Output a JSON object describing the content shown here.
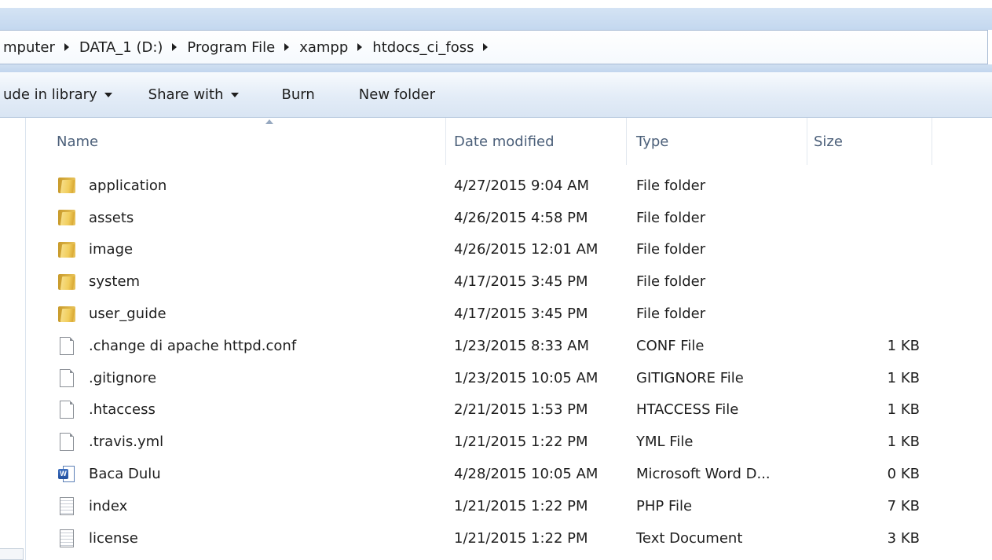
{
  "breadcrumbs": [
    {
      "label": "mputer"
    },
    {
      "label": "DATA_1 (D:)"
    },
    {
      "label": "Program File"
    },
    {
      "label": "xampp"
    },
    {
      "label": "htdocs_ci_foss"
    }
  ],
  "toolbar": {
    "include_library_label": "ude in library",
    "share_with_label": "Share with",
    "burn_label": "Burn",
    "new_folder_label": "New folder"
  },
  "columns": {
    "name": "Name",
    "date": "Date modified",
    "type": "Type",
    "size": "Size"
  },
  "files": [
    {
      "name": "application",
      "date": "4/27/2015 9:04 AM",
      "type": "File folder",
      "size": "",
      "icon": "folder-icon"
    },
    {
      "name": "assets",
      "date": "4/26/2015 4:58 PM",
      "type": "File folder",
      "size": "",
      "icon": "folder-icon"
    },
    {
      "name": "image",
      "date": "4/26/2015 12:01 AM",
      "type": "File folder",
      "size": "",
      "icon": "folder-icon"
    },
    {
      "name": "system",
      "date": "4/17/2015 3:45 PM",
      "type": "File folder",
      "size": "",
      "icon": "folder-icon"
    },
    {
      "name": "user_guide",
      "date": "4/17/2015 3:45 PM",
      "type": "File folder",
      "size": "",
      "icon": "folder-icon"
    },
    {
      "name": ".change di apache httpd.conf",
      "date": "1/23/2015 8:33 AM",
      "type": "CONF File",
      "size": "1 KB",
      "icon": "file-icon"
    },
    {
      "name": ".gitignore",
      "date": "1/23/2015 10:05 AM",
      "type": "GITIGNORE File",
      "size": "1 KB",
      "icon": "file-icon"
    },
    {
      "name": ".htaccess",
      "date": "2/21/2015 1:53 PM",
      "type": "HTACCESS File",
      "size": "1 KB",
      "icon": "file-icon"
    },
    {
      "name": ".travis.yml",
      "date": "1/21/2015 1:22 PM",
      "type": "YML File",
      "size": "1 KB",
      "icon": "file-icon"
    },
    {
      "name": "Baca Dulu",
      "date": "4/28/2015 10:05 AM",
      "type": "Microsoft Word D...",
      "size": "0 KB",
      "icon": "word-document-icon"
    },
    {
      "name": "index",
      "date": "1/21/2015 1:22 PM",
      "type": "PHP File",
      "size": "7 KB",
      "icon": "text-file-icon"
    },
    {
      "name": "license",
      "date": "1/21/2015 1:22 PM",
      "type": "Text Document",
      "size": "3 KB",
      "icon": "text-file-icon"
    }
  ]
}
